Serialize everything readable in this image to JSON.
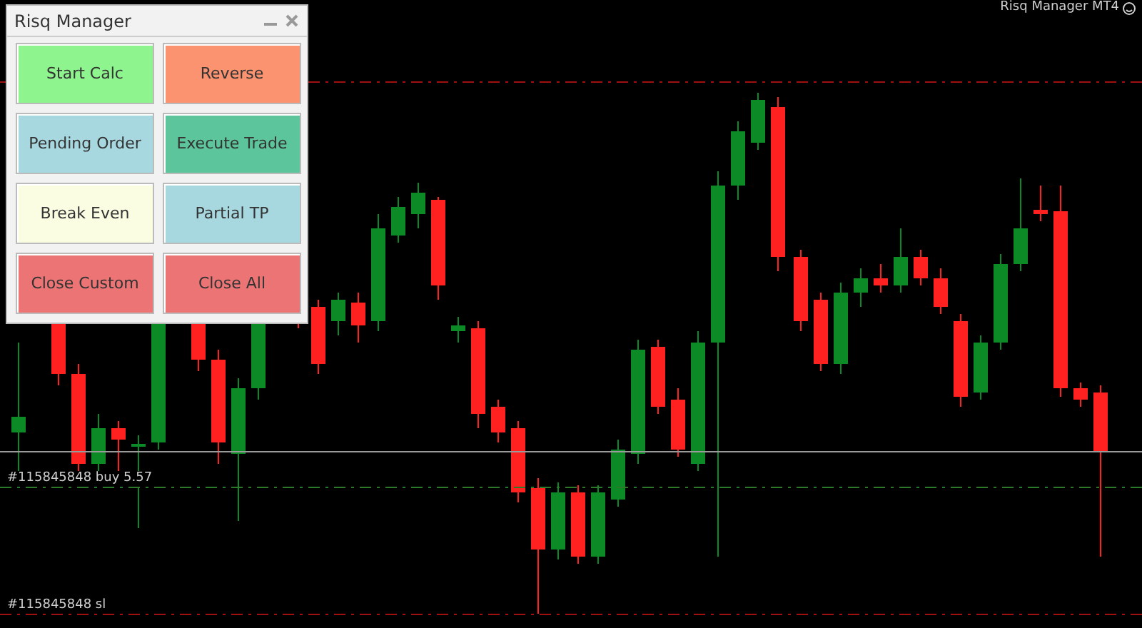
{
  "window": {
    "title": "Risq Manager"
  },
  "buttons": [
    {
      "label": "Start Calc",
      "color": "#8ef58e"
    },
    {
      "label": "Reverse",
      "color": "#fb9270"
    },
    {
      "label": "Pending Order",
      "color": "#a7d8e0"
    },
    {
      "label": "Execute Trade",
      "color": "#5cc59b"
    },
    {
      "label": "Break Even",
      "color": "#fbfde3"
    },
    {
      "label": "Partial TP",
      "color": "#a7d8e0"
    },
    {
      "label": "Close Custom",
      "color": "#ec7474"
    },
    {
      "label": "Close All",
      "color": "#ec7474"
    }
  ],
  "chart": {
    "expert_label": "Risq Manager MT4",
    "order_labels": [
      {
        "text": "#115845848 buy 5.57",
        "kind": "entry"
      },
      {
        "text": "#115845848 sl",
        "kind": "stop"
      }
    ]
  }
}
